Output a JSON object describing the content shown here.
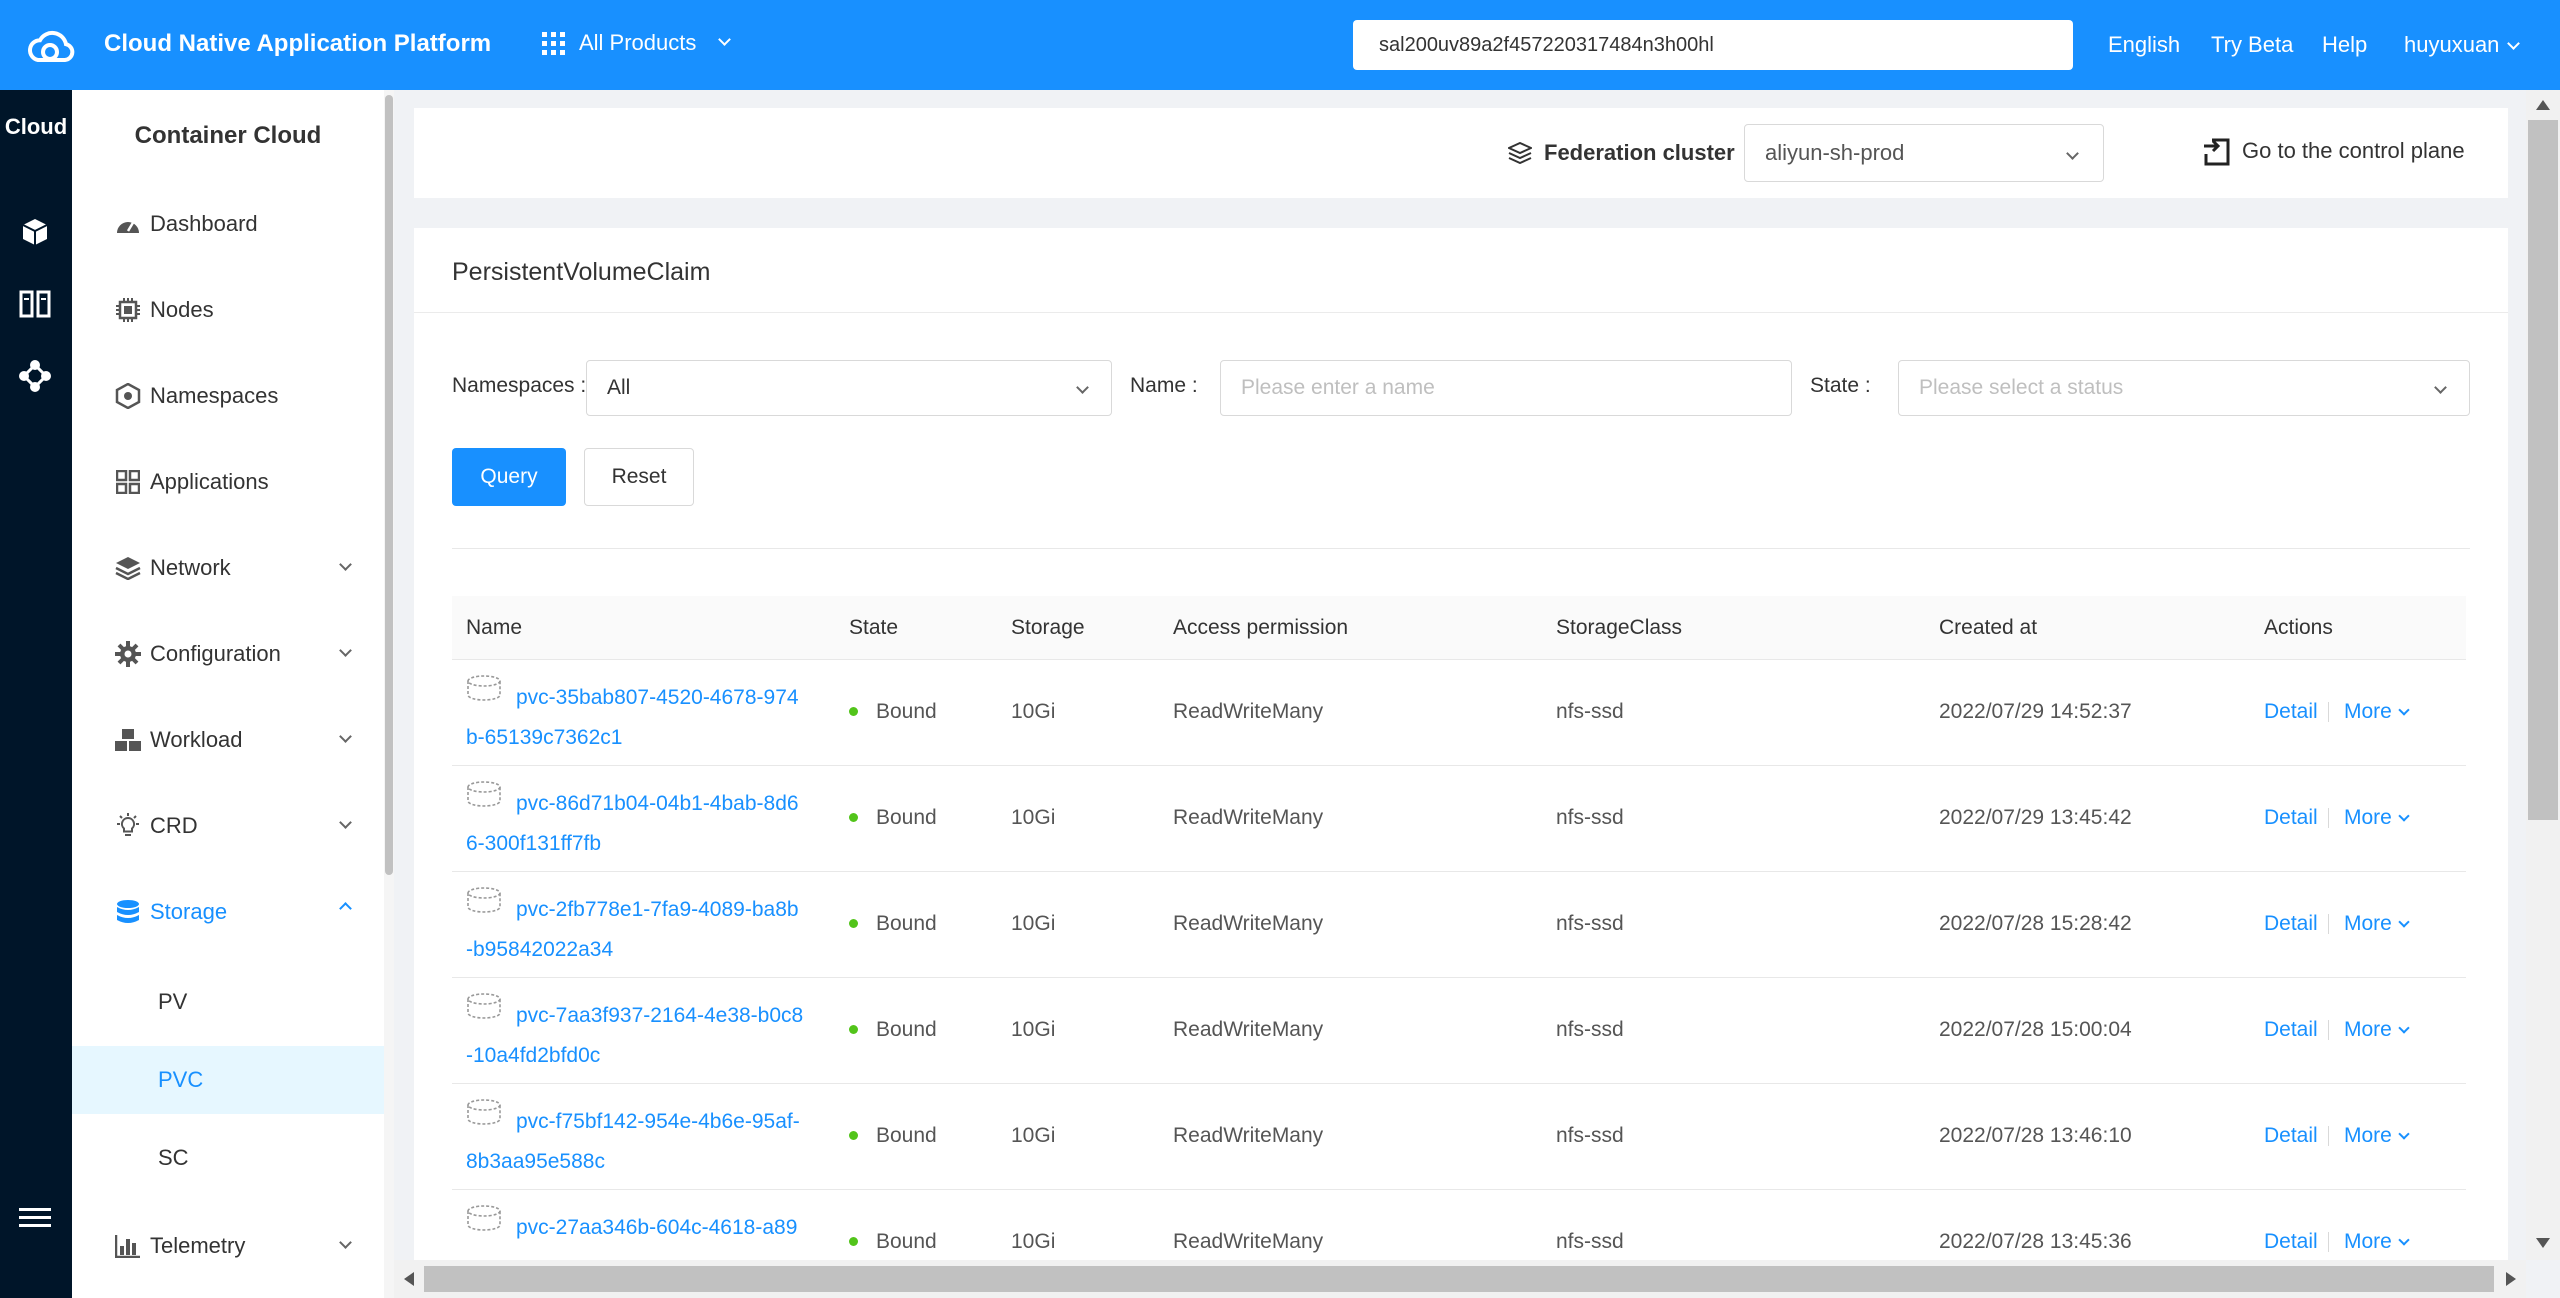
{
  "header": {
    "app_title": "Cloud Native Application Platform",
    "all_products": "All Products",
    "search_value": "sal200uv89a2f457220317484n3h00hl",
    "language": "English",
    "try_beta": "Try Beta",
    "help": "Help",
    "user": "huyuxuan"
  },
  "rail": {
    "title": "Cloud",
    "icons": [
      "cube-icon",
      "columns-icon",
      "cluster-nodes-icon",
      "menu-icon"
    ]
  },
  "sidebar": {
    "title": "Container Cloud",
    "items": [
      {
        "label": "Dashboard",
        "icon": "dashboard-icon"
      },
      {
        "label": "Nodes",
        "icon": "chip-icon"
      },
      {
        "label": "Namespaces",
        "icon": "namespace-icon"
      },
      {
        "label": "Applications",
        "icon": "apps-icon"
      },
      {
        "label": "Network",
        "icon": "layers-icon"
      },
      {
        "label": "Configuration",
        "icon": "gear-icon"
      },
      {
        "label": "Workload",
        "icon": "cubes-icon"
      },
      {
        "label": "CRD",
        "icon": "bulb-icon"
      },
      {
        "label": "Storage",
        "icon": "database-icon"
      },
      {
        "label": "Telemetry",
        "icon": "bar-chart-icon"
      }
    ],
    "storage_sub": [
      "PV",
      "PVC",
      "SC"
    ],
    "active_sub": "PVC"
  },
  "cluster_bar": {
    "federation_label": "Federation cluster",
    "cluster_value": "aliyun-sh-prod",
    "control_plane": "Go to the control plane"
  },
  "card": {
    "title": "PersistentVolumeClaim",
    "filters": {
      "namespaces_label": "Namespaces",
      "namespaces_value": "All",
      "name_label": "Name",
      "name_placeholder": "Please enter a name",
      "state_label": "State",
      "state_placeholder": "Please select a status",
      "query": "Query",
      "reset": "Reset"
    },
    "columns": [
      "Name",
      "State",
      "Storage",
      "Access permission",
      "StorageClass",
      "Created at",
      "Actions"
    ],
    "rows": [
      {
        "name1": "pvc-35bab807-4520-4678-974",
        "name2": "b-65139c7362c1",
        "state": "Bound",
        "storage": "10Gi",
        "access": "ReadWriteMany",
        "sc": "nfs-ssd",
        "created": "2022/07/29 14:52:37"
      },
      {
        "name1": "pvc-86d71b04-04b1-4bab-8d6",
        "name2": "6-300f131ff7fb",
        "state": "Bound",
        "storage": "10Gi",
        "access": "ReadWriteMany",
        "sc": "nfs-ssd",
        "created": "2022/07/29 13:45:42"
      },
      {
        "name1": "pvc-2fb778e1-7fa9-4089-ba8b",
        "name2": "-b95842022a34",
        "state": "Bound",
        "storage": "10Gi",
        "access": "ReadWriteMany",
        "sc": "nfs-ssd",
        "created": "2022/07/28 15:28:42"
      },
      {
        "name1": "pvc-7aa3f937-2164-4e38-b0c8",
        "name2": "-10a4fd2bfd0c",
        "state": "Bound",
        "storage": "10Gi",
        "access": "ReadWriteMany",
        "sc": "nfs-ssd",
        "created": "2022/07/28 15:00:04"
      },
      {
        "name1": "pvc-f75bf142-954e-4b6e-95af-",
        "name2": "8b3aa95e588c",
        "state": "Bound",
        "storage": "10Gi",
        "access": "ReadWriteMany",
        "sc": "nfs-ssd",
        "created": "2022/07/28 13:46:10"
      },
      {
        "name1": "pvc-27aa346b-604c-4618-a89",
        "name2": "",
        "state": "Bound",
        "storage": "10Gi",
        "access": "ReadWriteMany",
        "sc": "nfs-ssd",
        "created": "2022/07/28 13:45:36"
      }
    ],
    "action_detail": "Detail",
    "action_more": "More"
  },
  "colors": {
    "primary": "#1890ff",
    "rail_bg": "#001529",
    "success": "#52c41a"
  }
}
